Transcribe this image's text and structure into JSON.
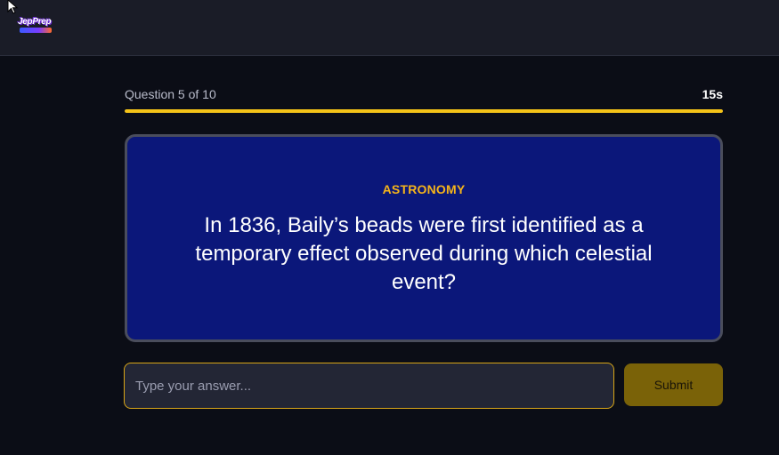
{
  "header": {
    "logo_text": "JepPrep"
  },
  "quiz": {
    "question_counter": "Question 5 of 10",
    "timer": "15s",
    "progress": 1.0,
    "category": "ASTRONOMY",
    "question": "In 1836, Baily’s beads were first identified as a temporary effect observed during which celestial event?"
  },
  "answer": {
    "placeholder": "Type your answer...",
    "value": ""
  },
  "submit_label": "Submit",
  "colors": {
    "accent": "#f5c318",
    "card_background": "#0b177a",
    "page_background": "#0b0d16"
  }
}
